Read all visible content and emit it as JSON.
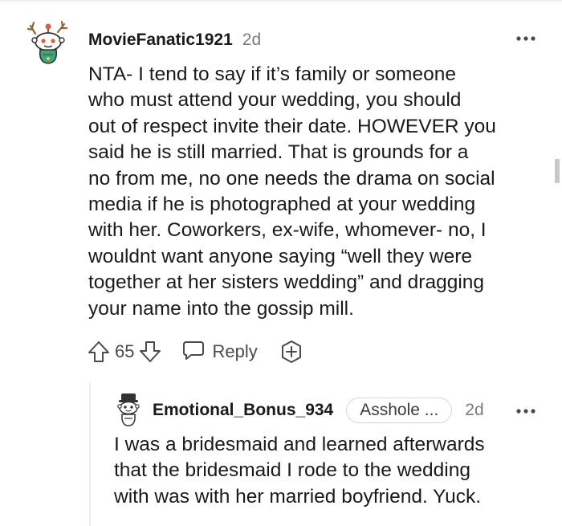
{
  "comment": {
    "username": "MovieFanatic1921",
    "age": "2d",
    "body_lines": [
      "NTA- I tend to say if it’s family or someone",
      "who must attend your wedding, you should",
      "out of respect invite their date. HOWEVER you",
      "said he is still married. That is grounds for a",
      "no from me, no one needs the drama on social",
      "media if he is photographed at your wedding",
      "with her. Coworkers, ex-wife, whomever- no, I",
      "wouldnt want anyone saying “well they were",
      "together at her sisters wedding” and dragging",
      "your name into the gossip mill."
    ],
    "score": "65",
    "reply_label": "Reply",
    "icons": {
      "avatar": "snoo-avatar-icon",
      "more": "more-options-icon",
      "upvote": "upvote-arrow-icon",
      "downvote": "downvote-arrow-icon",
      "reply": "speech-bubble-icon",
      "award": "award-plus-icon"
    }
  },
  "reply": {
    "username": "Emotional_Bonus_934",
    "flair": "Asshole ...",
    "age": "2d",
    "body_lines": [
      "I was a bridesmaid and learned afterwards",
      "that the bridesmaid I rode to the wedding",
      "with was with her married boyfriend. Yuck."
    ],
    "icons": {
      "avatar": "snoo-avatar-icon",
      "more": "more-options-icon"
    }
  },
  "colors": {
    "text": "#1a1a1b",
    "meta": "#787c7e",
    "action": "#4a4a4a",
    "divider": "#edeff1",
    "avatar_accent": "#3ca57c"
  }
}
